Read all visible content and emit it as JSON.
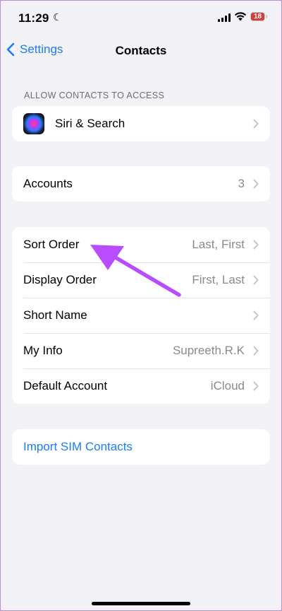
{
  "status_bar": {
    "time": "11:29",
    "battery": "18"
  },
  "nav": {
    "back_label": "Settings",
    "title": "Contacts"
  },
  "section_header": "ALLOW CONTACTS TO ACCESS",
  "siri_row": {
    "label": "Siri & Search"
  },
  "accounts_row": {
    "label": "Accounts",
    "value": "3"
  },
  "settings_rows": [
    {
      "label": "Sort Order",
      "value": "Last, First"
    },
    {
      "label": "Display Order",
      "value": "First, Last"
    },
    {
      "label": "Short Name",
      "value": ""
    },
    {
      "label": "My Info",
      "value": "Supreeth.R.K"
    },
    {
      "label": "Default Account",
      "value": "iCloud"
    }
  ],
  "import_row": {
    "label": "Import SIM Contacts"
  },
  "colors": {
    "accent": "#1a7ef5",
    "annotation_arrow": "#b84dff",
    "background": "#f2f2f7"
  },
  "icons": [
    "moon-icon",
    "signal-icon",
    "wifi-icon",
    "battery-icon",
    "back-chevron-icon",
    "siri-icon",
    "chevron-right-icon",
    "annotation-arrow"
  ]
}
